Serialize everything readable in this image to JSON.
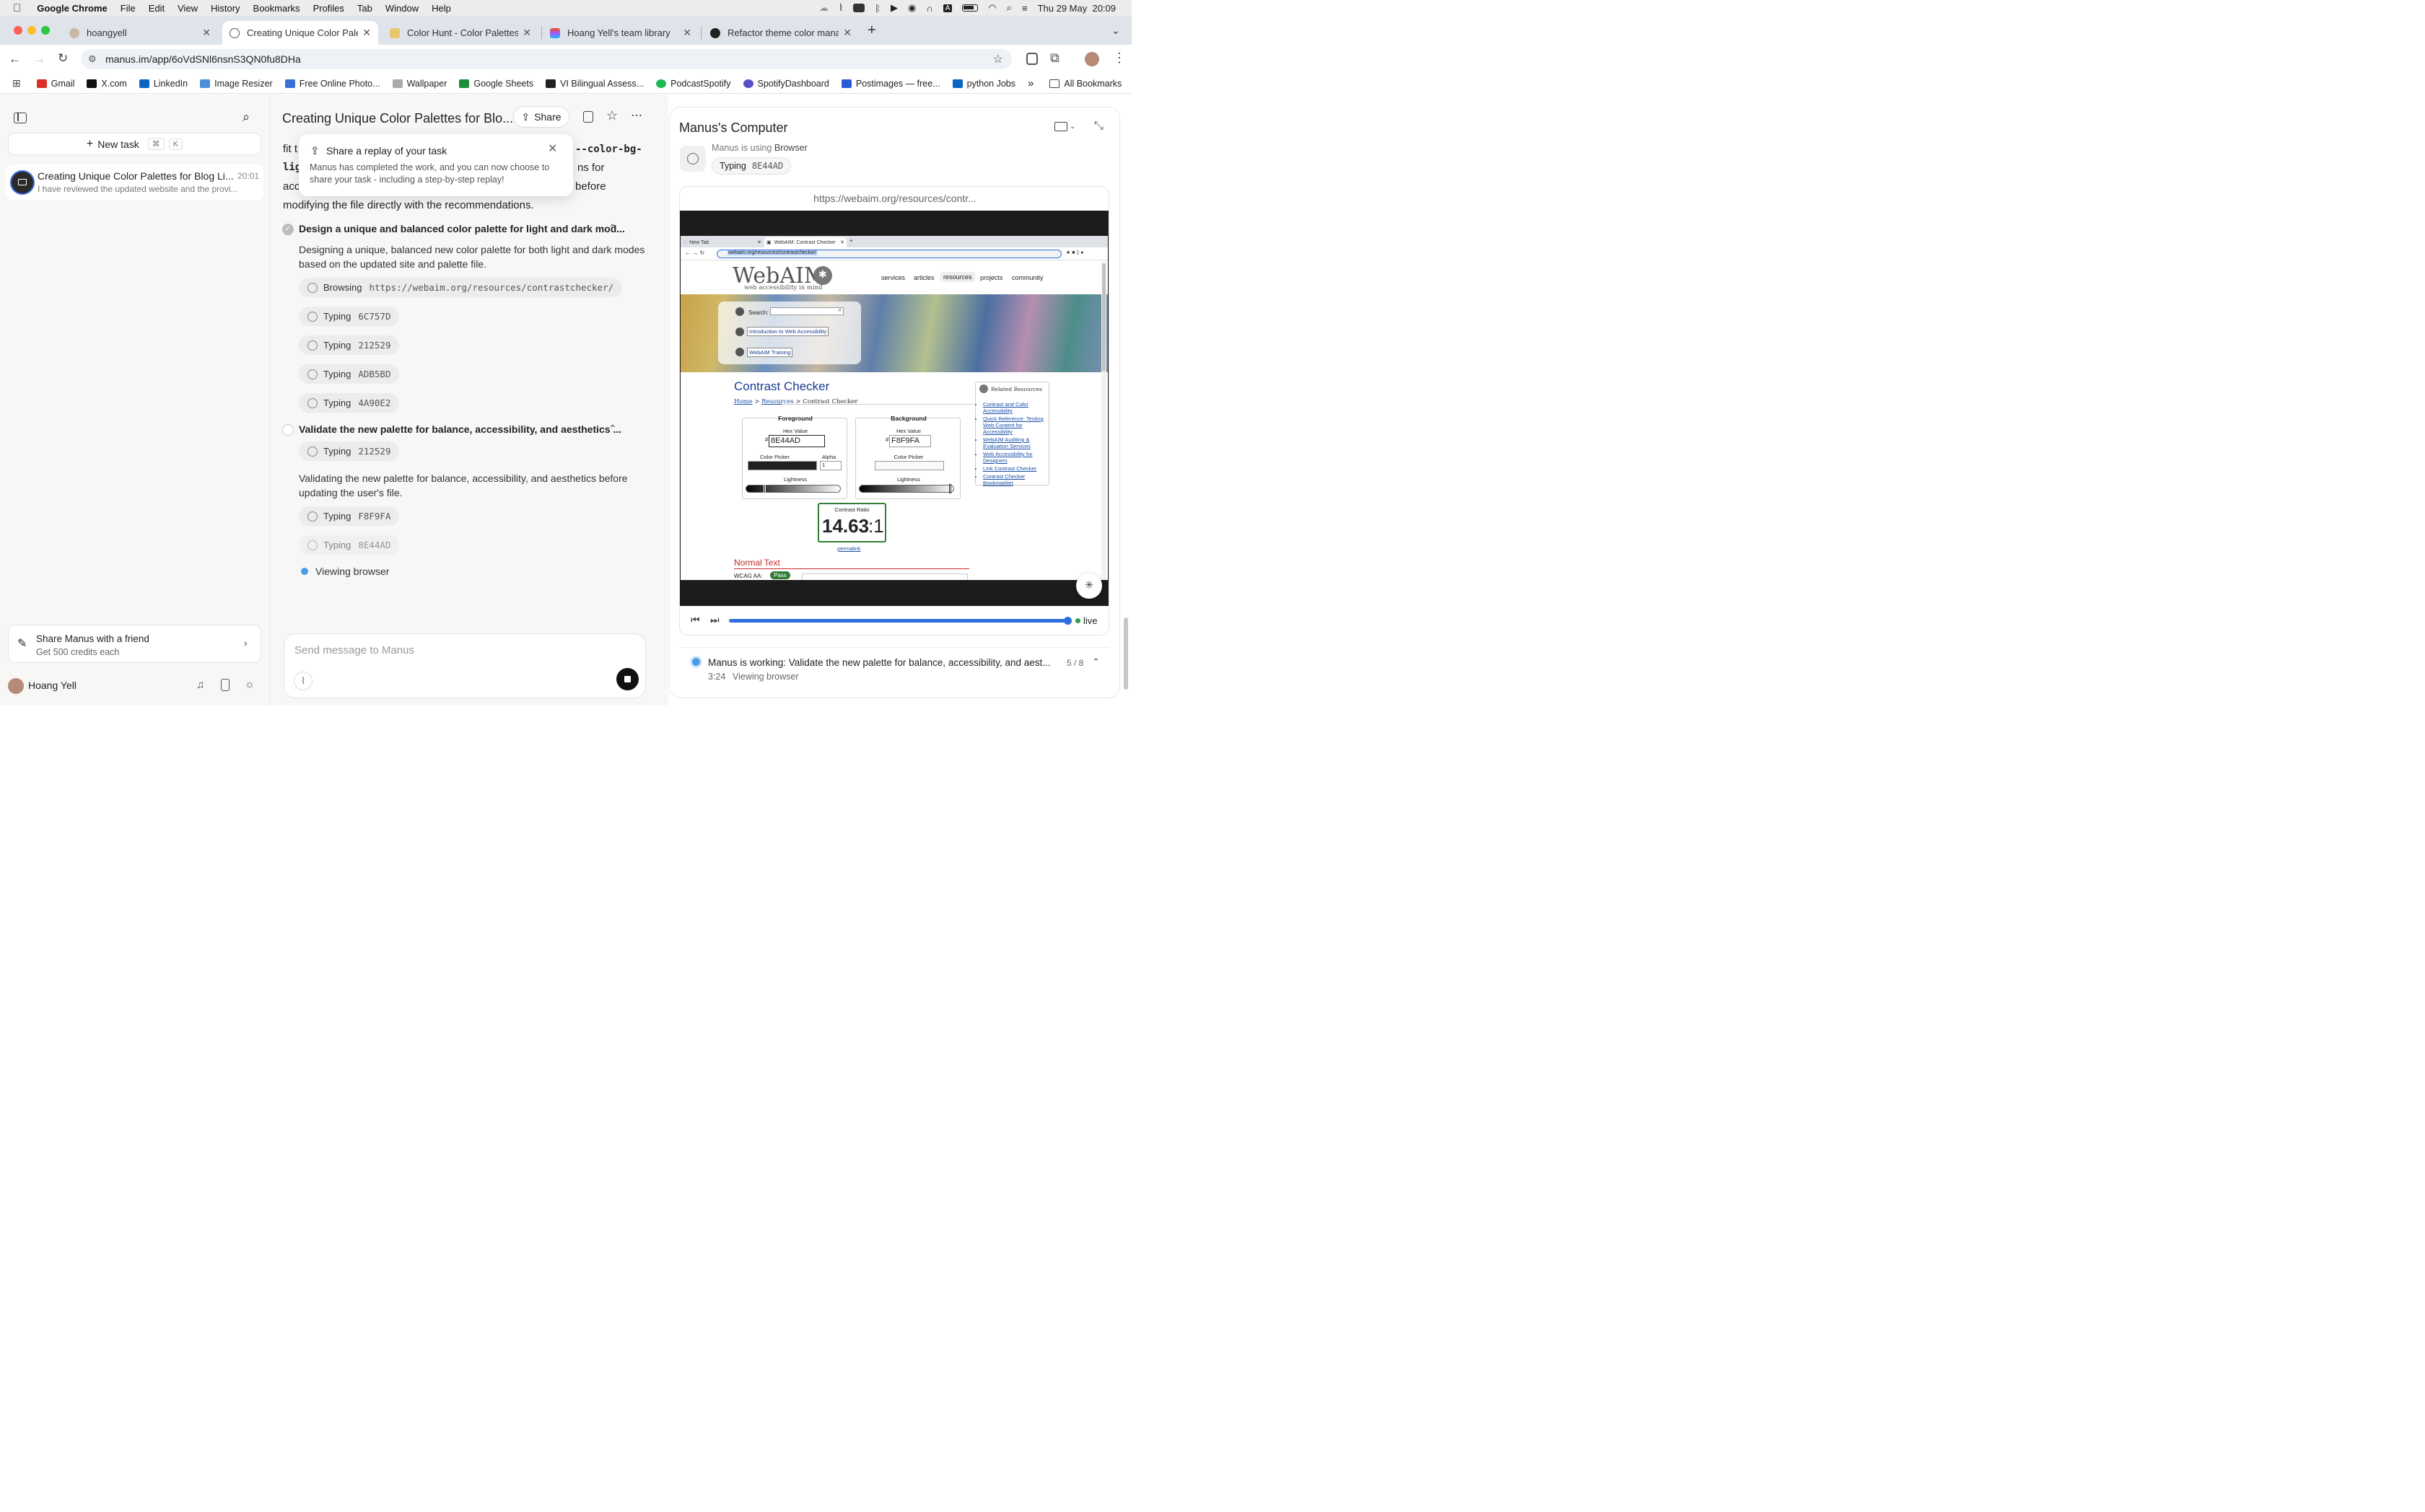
{
  "menubar": {
    "app": "Google Chrome",
    "items": [
      "File",
      "Edit",
      "View",
      "History",
      "Bookmarks",
      "Profiles",
      "Tab",
      "Window",
      "Help"
    ],
    "datetime": "Thu 29 May  20:09"
  },
  "tabs": [
    {
      "title": "hoangyell",
      "active": false
    },
    {
      "title": "Creating Unique Color Palette",
      "active": true
    },
    {
      "title": "Color Hunt - Color Palettes fo",
      "active": false
    },
    {
      "title": "Hoang Yell's team library",
      "active": false
    },
    {
      "title": "Refactor theme color manage",
      "active": false
    }
  ],
  "address": {
    "url": "manus.im/app/6oVdSNl6nsnS3QN0fu8DHa"
  },
  "bookmarks": [
    {
      "label": "Gmail",
      "color": "#d93025"
    },
    {
      "label": "X.com",
      "color": "#111111"
    },
    {
      "label": "LinkedIn",
      "color": "#0a66c2"
    },
    {
      "label": "Image Resizer",
      "color": "#4a8fd8"
    },
    {
      "label": "Free Online Photo...",
      "color": "#3a6fd8"
    },
    {
      "label": "Wallpaper",
      "color": "#888888"
    },
    {
      "label": "Google Sheets",
      "color": "#1e8e3e"
    },
    {
      "label": "VI Bilingual Assess...",
      "color": "#222222"
    },
    {
      "label": "PodcastSpotify",
      "color": "#1db954"
    },
    {
      "label": "SpotifyDashboard",
      "color": "#5b4fc8"
    },
    {
      "label": "Postimages — free...",
      "color": "#2a5bd7"
    },
    {
      "label": "python Jobs",
      "color": "#0a66c2"
    }
  ],
  "bookmarks_all": "All Bookmarks",
  "sidebar": {
    "new_task": "New task",
    "shortcut_cmd": "⌘",
    "shortcut_key": "K",
    "task": {
      "title": "Creating Unique Color Palettes for Blog Li...",
      "time": "20:01",
      "preview": "I have reviewed the updated website and the provi..."
    },
    "share_title": "Share Manus with a friend",
    "share_sub": "Get 500 credits each",
    "user": "Hoang Yell"
  },
  "main": {
    "title": "Creating Unique Color Palettes for Blo...",
    "share_button": "Share",
    "partial_lines": [
      "fit t",
      "lig",
      "acc",
      "modifying the file directly with the recommendations."
    ],
    "partial_right": [
      "--color-bg-",
      "ns for",
      "before"
    ],
    "popup": {
      "title": "Share a replay of your task",
      "body": "Manus has completed the work, and you can now choose to share your task - including a step-by-step replay!"
    },
    "step1": {
      "title": "Design a unique and balanced color palette for light and dark mod...",
      "desc": "Designing a unique, balanced new color palette for both light and dark modes based on the updated site and palette file.",
      "chips": [
        {
          "verb": "Browsing",
          "value": "https://webaim.org/resources/contrastchecker/"
        },
        {
          "verb": "Typing",
          "value": "6C757D"
        },
        {
          "verb": "Typing",
          "value": "212529"
        },
        {
          "verb": "Typing",
          "value": "ADB5BD"
        },
        {
          "verb": "Typing",
          "value": "4A90E2"
        }
      ]
    },
    "step2": {
      "title": "Validate the new palette for balance, accessibility, and aesthetics ...",
      "desc": "Validating the new palette for balance, accessibility, and aesthetics before updating the user's file.",
      "chip_a": {
        "verb": "Typing",
        "value": "212529"
      },
      "chips": [
        {
          "verb": "Typing",
          "value": "F8F9FA"
        },
        {
          "verb": "Typing",
          "value": "8E44AD"
        }
      ]
    },
    "viewing": "Viewing browser",
    "input_placeholder": "Send message to Manus"
  },
  "computer": {
    "title": "Manus's Computer",
    "using_prefix": "Manus is using",
    "using_app": "Browser",
    "action_verb": "Typing",
    "action_value": "8E44AD",
    "frame_url": "https://webaim.org/resources/contr...",
    "live": "live",
    "progress": 0.99,
    "status": "Manus is working: Validate the new palette for balance, accessibility, and aest...",
    "step_count": "5 / 8",
    "elapsed": "3:24",
    "elapsed_label": "Viewing browser"
  },
  "webaim": {
    "tab1": "New Tab",
    "tab2": "WebAIM: Contrast Checker",
    "url": "webaim.org/resources/contrastchecker/",
    "logo": "WebAIM",
    "tagline": "web accessibility in mind",
    "nav": [
      "services",
      "articles",
      "resources",
      "projects",
      "community"
    ],
    "search_label": "Search:",
    "btn1": "Introduction to Web Accessibility",
    "btn2": "WebAIM Training",
    "heading": "Contrast Checker",
    "crumb_home": "Home",
    "crumb_res": "Resources",
    "crumb_cur": "Contrast Checker",
    "crumb_sep": ">",
    "fg_label": "Foreground",
    "bg_label": "Background",
    "hex_label": "Hex Value",
    "fg_hex": "8E44AD",
    "bg_hex": "F8F9FA",
    "hash": "#",
    "picker_label": "Color Picker",
    "alpha_label": "Alpha",
    "alpha_val": "1",
    "lightness_label": "Lightness",
    "ratio_label": "Contrast Ratio",
    "ratio_big": "14.63",
    "ratio_small": ":1",
    "permalink": "permalink",
    "normal_text": "Normal Text",
    "wcag": "WCAG AA:",
    "pass": "Pass",
    "related_title": "Related Resources",
    "related": [
      "Contrast and Color Accessibility",
      "Quick Reference: Testing Web Content for Accessibility",
      "WebAIM Auditing & Evaluation Services",
      "Web Accessibility for Designers",
      "Link Contrast Checker",
      "Contrast Checker Bookmarklet"
    ]
  },
  "colors": {
    "accent": "#2f6fdc",
    "pass": "#2e7d32",
    "heading_blue": "#1a3d8f",
    "normal_text_red": "#c62828"
  }
}
